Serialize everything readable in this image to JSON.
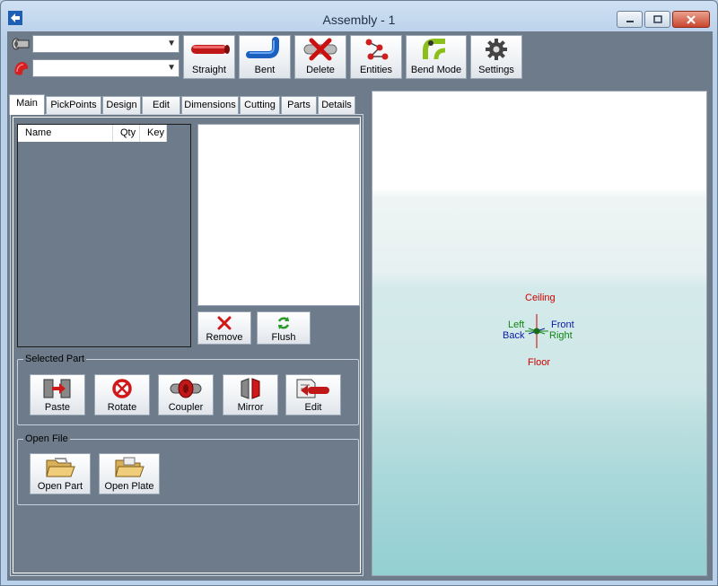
{
  "window": {
    "title": "Assembly - 1"
  },
  "toolbar": {
    "combo1_value": "",
    "combo2_value": "",
    "buttons": [
      {
        "label": "Straight",
        "icon": "straight-tube-icon"
      },
      {
        "label": "Bent",
        "icon": "bent-tube-icon"
      },
      {
        "label": "Delete",
        "icon": "delete-tube-icon"
      },
      {
        "label": "Entities",
        "icon": "entities-icon"
      },
      {
        "label": "Bend Mode",
        "icon": "bend-mode-icon"
      },
      {
        "label": "Settings",
        "icon": "gear-icon"
      }
    ]
  },
  "tabs": [
    "Main",
    "PickPoints",
    "Design",
    "Edit",
    "Dimensions",
    "Cutting",
    "Parts",
    "Details"
  ],
  "active_tab": "Main",
  "parts_list": {
    "columns": [
      "Name",
      "Qty",
      "Key"
    ],
    "rows": []
  },
  "list_actions": {
    "remove": "Remove",
    "flush": "Flush"
  },
  "selected_part": {
    "legend": "Selected Part",
    "buttons": [
      {
        "label": "Paste",
        "icon": "paste-icon"
      },
      {
        "label": "Rotate",
        "icon": "rotate-icon"
      },
      {
        "label": "Coupler",
        "icon": "coupler-icon"
      },
      {
        "label": "Mirror",
        "icon": "mirror-icon"
      },
      {
        "label": "Edit",
        "icon": "edit-part-icon"
      }
    ]
  },
  "open_file": {
    "legend": "Open File",
    "buttons": [
      {
        "label": "Open Part",
        "icon": "open-folder-icon"
      },
      {
        "label": "Open Plate",
        "icon": "open-folder-icon"
      }
    ]
  },
  "viewport": {
    "ceiling": "Ceiling",
    "floor": "Floor",
    "left": "Left",
    "back": "Back",
    "front": "Front",
    "right": "Right",
    "colors": {
      "vertical": "#cc0000",
      "left_right": "#118811",
      "front_back": "#0a1aa8"
    }
  }
}
